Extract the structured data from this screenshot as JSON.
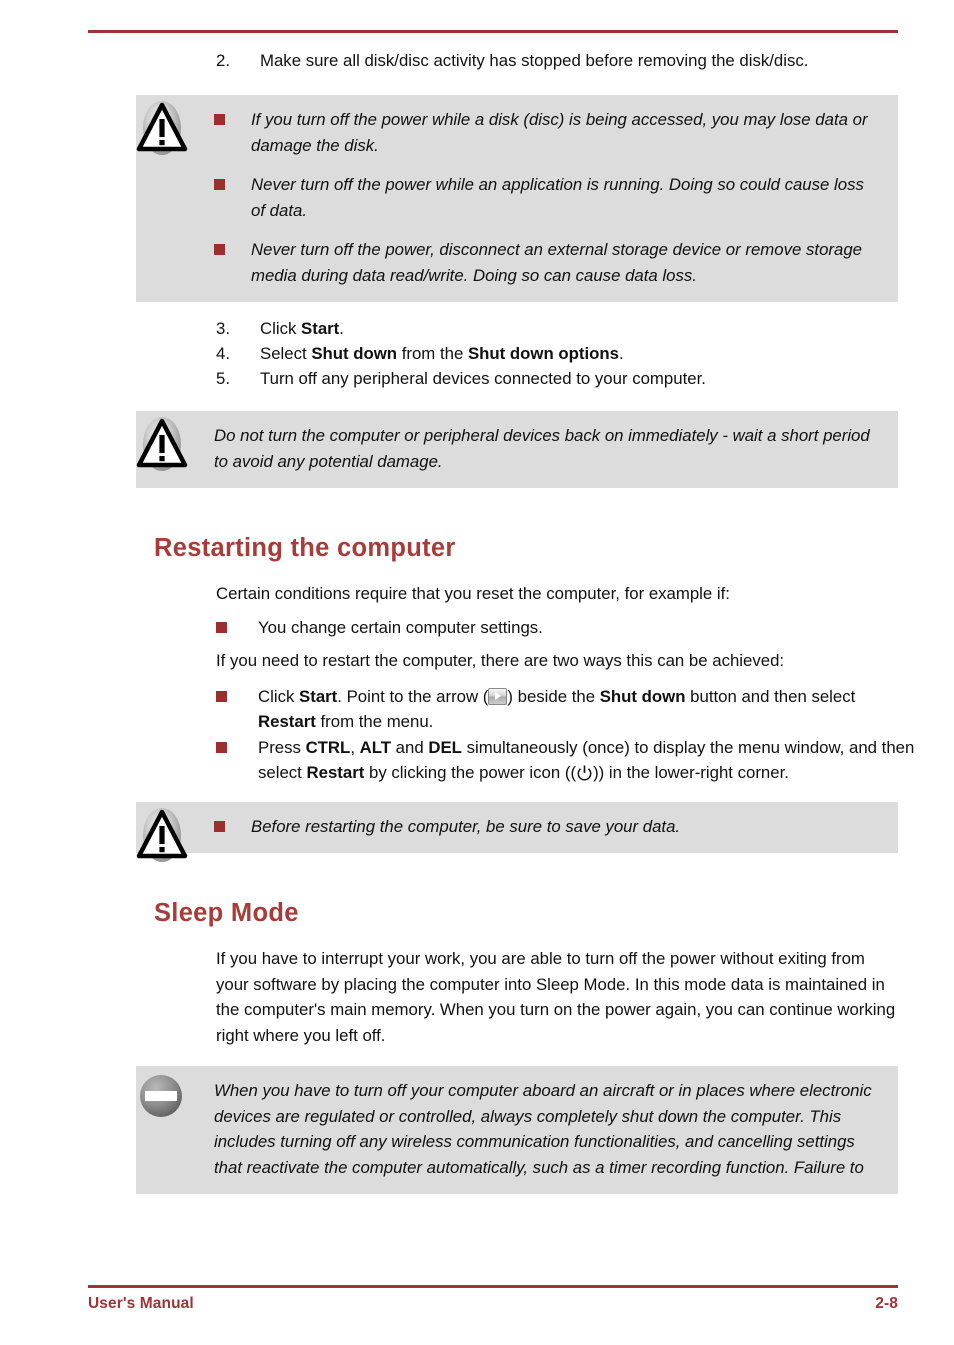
{
  "colors": {
    "accent_red": "#9d3434",
    "heading_red": "#a83c39",
    "bullet_red": "#9b2f2f",
    "note_bg": "#dcdcdc",
    "text": "#111111"
  },
  "header": {
    "rule": "horizontal-red-rule"
  },
  "steps_top": [
    {
      "num": "2.",
      "text": "Make sure all disk/disc activity has stopped before removing the disk/disc."
    }
  ],
  "note_caution_1": {
    "icon": "warning-triangle-icon",
    "items": [
      "If you turn off the power while a disk (disc) is being accessed, you may lose data or damage the disk.",
      "Never turn off the power while an application is running. Doing so could cause loss of data.",
      "Never turn off the power, disconnect an external storage device or remove storage media during data read/write. Doing so can cause data loss."
    ]
  },
  "steps_bottom": [
    {
      "num": "3.",
      "pre": "Click ",
      "bold": "Start",
      "post": "."
    },
    {
      "num": "4.",
      "pre": "Select ",
      "bold": "Shut down",
      "mid": " from the ",
      "bold2": "Shut down options",
      "post": "."
    },
    {
      "num": "5.",
      "pre": "Turn off any peripheral devices connected to your computer.",
      "bold": "",
      "post": ""
    }
  ],
  "note_caution_2": {
    "icon": "warning-triangle-icon",
    "text": "Do not turn the computer or peripheral devices back on immediately - wait a short period to avoid any potential damage."
  },
  "section_restart": {
    "heading": "Restarting the computer",
    "intro": "Certain conditions require that you reset the computer, for example if:",
    "bullets_condition": [
      "You change certain computer settings."
    ],
    "intro2": "If you need to restart the computer, there are two ways this can be achieved:",
    "method_1": {
      "p1": "Click ",
      "b1": "Start",
      "p2": ". Point to the arrow (",
      "icon": "arrow-right-button-icon",
      "p3": ") beside the ",
      "b2": "Shut down",
      "p4": " button and then select ",
      "b3": "Restart",
      "p5": " from the menu."
    },
    "method_2": {
      "p1": "Press ",
      "b1": "CTRL",
      "p2": ", ",
      "b2": "ALT",
      "p3": " and ",
      "b3": "DEL",
      "p4": " simultaneously (once) to display the menu window, and then select ",
      "b4": "Restart",
      "p5": " by clicking the power icon ((",
      "icon": "power-symbol-icon",
      "p6": ")) in the lower-right corner."
    },
    "note": {
      "icon": "warning-triangle-icon",
      "items": [
        "Before restarting the computer, be sure to save your data."
      ]
    }
  },
  "section_sleep": {
    "heading": "Sleep Mode",
    "intro": "If you have to interrupt your work, you are able to turn off the power without exiting from your software by placing the computer into Sleep Mode. In this mode data is maintained in the computer's main memory. When you turn on the power again, you can continue working right where you left off.",
    "note": {
      "icon": "prohibition-circle-icon",
      "text": "When you have to turn off your computer aboard an aircraft or in places where electronic devices are regulated or controlled, always completely shut down the computer. This includes turning off any wireless communication functionalities, and cancelling settings that reactivate the computer automatically, such as a timer recording function. Failure to"
    }
  },
  "footer": {
    "left": "User's Manual",
    "right": "2-8"
  }
}
